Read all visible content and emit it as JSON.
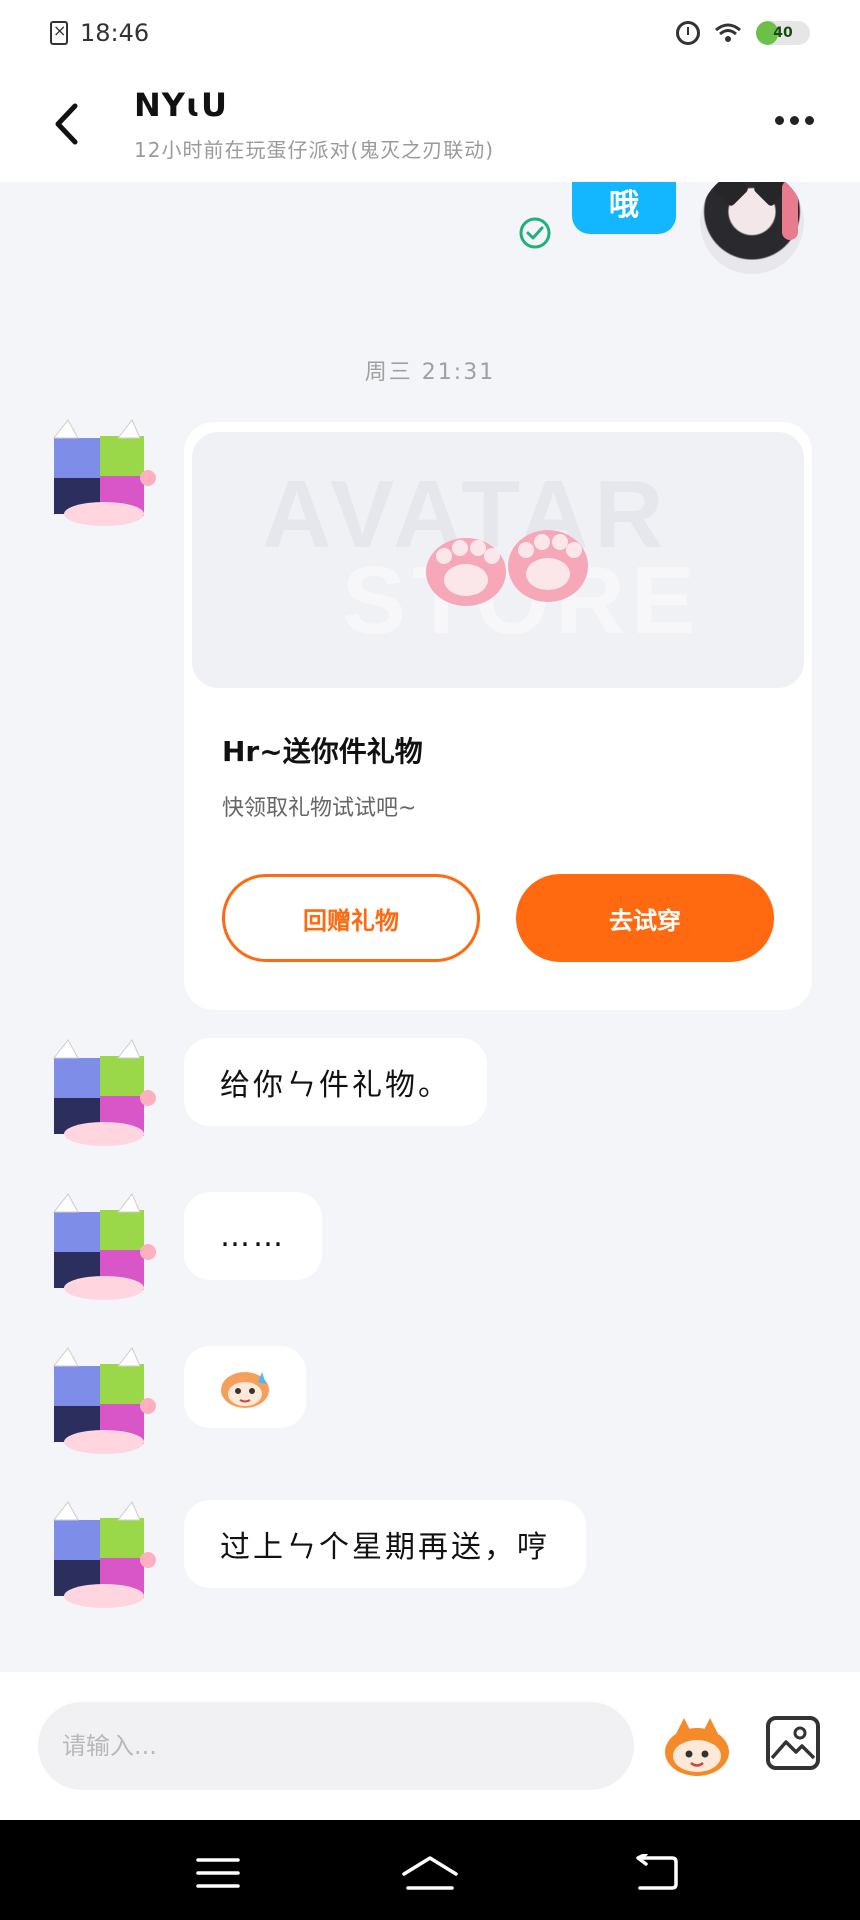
{
  "status_bar": {
    "time": "18:46",
    "battery_level": "40",
    "battery_fraction": 0.4
  },
  "header": {
    "name": "NYɩU",
    "status": "12小时前在玩蛋仔派对(鬼灭之刃联动)"
  },
  "messages": {
    "sent_text": "哦",
    "timestamp": "周三 21:31",
    "gift_card": {
      "watermark_line1": "AVATAR",
      "watermark_line2": "STORE",
      "title": "Hr~送你件礼物",
      "subtitle": "快领取礼物试试吧~",
      "regift_label": "回赠礼物",
      "try_on_label": "去试穿"
    },
    "text1": "给你ㄣ件礼物。",
    "text2": "……",
    "text4": "过上ㄣ个星期再送，哼"
  },
  "input": {
    "placeholder": "请输入..."
  },
  "colors": {
    "accent_orange": "#ff6a10",
    "sent_bubble": "#13b7ff",
    "read_check": "#20b07a",
    "chat_bg": "#f4f5f9"
  }
}
